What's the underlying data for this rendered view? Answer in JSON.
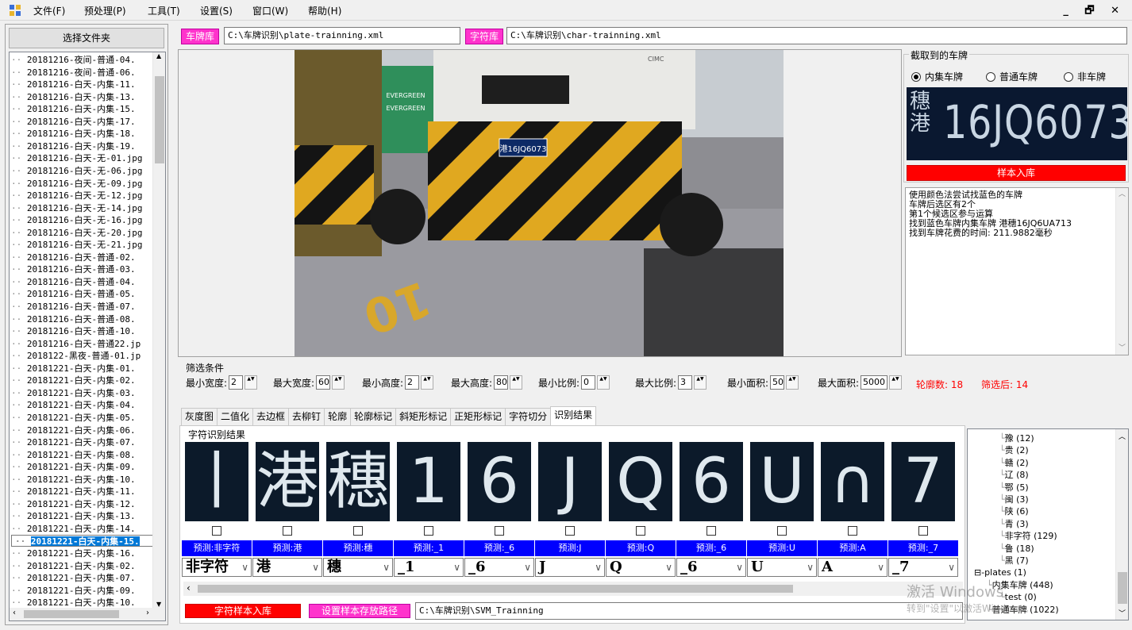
{
  "menu": {
    "items": [
      "文件(F)",
      "预处理(P)",
      "工具(T)",
      "设置(S)",
      "窗口(W)",
      "帮助(H)"
    ],
    "window_controls": "_ 🗗 ✕"
  },
  "left": {
    "folder_button": "选择文件夹",
    "files": [
      "20181216-夜间-普通-04.",
      "20181216-夜间-普通-06.",
      "20181216-白天-内集-11.",
      "20181216-白天-内集-13.",
      "20181216-白天-内集-15.",
      "20181216-白天-内集-17.",
      "20181216-白天-内集-18.",
      "20181216-白天-内集-19.",
      "20181216-白天-无-01.jpg",
      "20181216-白天-无-06.jpg",
      "20181216-白天-无-09.jpg",
      "20181216-白天-无-12.jpg",
      "20181216-白天-无-14.jpg",
      "20181216-白天-无-16.jpg",
      "20181216-白天-无-20.jpg",
      "20181216-白天-无-21.jpg",
      "20181216-白天-普通-02.",
      "20181216-白天-普通-03.",
      "20181216-白天-普通-04.",
      "20181216-白天-普通-05.",
      "20181216-白天-普通-07.",
      "20181216-白天-普通-08.",
      "20181216-白天-普通-10.",
      "20181216-白天-普通22.jp",
      "2018122-黑夜-普通-01.jp",
      "20181221-白天-内集-01.",
      "20181221-白天-内集-02.",
      "20181221-白天-内集-03.",
      "20181221-白天-内集-04.",
      "20181221-白天-内集-05.",
      "20181221-白天-内集-06.",
      "20181221-白天-内集-07.",
      "20181221-白天-内集-08.",
      "20181221-白天-内集-09.",
      "20181221-白天-内集-10.",
      "20181221-白天-内集-11.",
      "20181221-白天-内集-12.",
      "20181221-白天-内集-13.",
      "20181221-白天-内集-14.",
      "20181221-白天-内集-15.",
      "20181221-白天-内集-16.",
      "20181221-白天-内集-02.",
      "20181221-白天-内集-07.",
      "20181221-白天-内集-09.",
      "20181221-白天-内集-10."
    ],
    "selected_index": 39
  },
  "paths": {
    "plate_tag": "车牌库",
    "plate_path": "C:\\车牌识别\\plate-trainning.xml",
    "char_tag": "字符库",
    "char_path": "C:\\车牌识别\\char-trainning.xml"
  },
  "scene": {
    "banner1": "EVERGREEN",
    "banner2": "EVERGREEN",
    "plate_small": "港16JQ6073",
    "ground_number": "10",
    "truck_brand": "CIMC"
  },
  "plate_panel": {
    "title": "截取到的车牌",
    "options": [
      "内集车牌",
      "普通车牌",
      "非车牌"
    ],
    "selected_option": 0,
    "plate_prefix_top": "穗",
    "plate_prefix_bottom": "港",
    "plate_text": "16JQ6073",
    "sample_button": "样本入库"
  },
  "log": {
    "lines": [
      "使用颜色法尝试找蓝色的车牌",
      "车牌后选区有2个",
      "第1个候选区参与运算",
      "找到蓝色车牌内集车牌 港穗16JQ6UA713",
      "找到车牌花费的时间: 211.9882毫秒"
    ]
  },
  "filter": {
    "title": "筛选条件",
    "fields": [
      {
        "label": "最小宽度:",
        "value": "2"
      },
      {
        "label": "最大宽度:",
        "value": "60"
      },
      {
        "label": "最小高度:",
        "value": "2"
      },
      {
        "label": "最大高度:",
        "value": "80"
      },
      {
        "label": "最小比例:",
        "value": "0"
      },
      {
        "label": "最大比例:",
        "value": "3"
      },
      {
        "label": "最小面积:",
        "value": "50"
      },
      {
        "label": "最大面积:",
        "value": "5000"
      }
    ],
    "contour_count": "轮廓数: 18",
    "after_filter": "筛选后: 14"
  },
  "tabs": {
    "items": [
      "灰度图",
      "二值化",
      "去边框",
      "去柳钉",
      "轮廓",
      "轮廓标记",
      "斜矩形标记",
      "正矩形标记",
      "字符切分",
      "识别结果"
    ],
    "active": 9
  },
  "recognition": {
    "title": "字符识别结果",
    "chars": [
      {
        "glyph": "丨",
        "pred": "预测:非字符",
        "select": "非字符"
      },
      {
        "glyph": "港",
        "pred": "预测:港",
        "select": "港"
      },
      {
        "glyph": "穗",
        "pred": "预测:穗",
        "select": "穗"
      },
      {
        "glyph": "1",
        "pred": "预测:_1",
        "select": "_1"
      },
      {
        "glyph": "6",
        "pred": "预测:_6",
        "select": "_6"
      },
      {
        "glyph": "J",
        "pred": "预测:J",
        "select": "J"
      },
      {
        "glyph": "Q",
        "pred": "预测:Q",
        "select": "Q"
      },
      {
        "glyph": "6",
        "pred": "预测:_6",
        "select": "_6"
      },
      {
        "glyph": "U",
        "pred": "预测:U",
        "select": "U"
      },
      {
        "glyph": "∩",
        "pred": "预测:A",
        "select": "A"
      },
      {
        "glyph": "7",
        "pred": "预测:_7",
        "select": "_7"
      }
    ],
    "char_sample_button": "字符样本入库",
    "set_path_button": "设置样本存放路径",
    "sample_path": "C:\\车牌识别\\SVM_Trainning"
  },
  "tree": {
    "nodes": [
      {
        "text": "豫 (12)",
        "indent": 2
      },
      {
        "text": "贵 (2)",
        "indent": 2
      },
      {
        "text": "赣 (2)",
        "indent": 2
      },
      {
        "text": "辽 (8)",
        "indent": 2
      },
      {
        "text": "鄂 (5)",
        "indent": 2
      },
      {
        "text": "闽 (3)",
        "indent": 2
      },
      {
        "text": "陕 (6)",
        "indent": 2
      },
      {
        "text": "青 (3)",
        "indent": 2
      },
      {
        "text": "非字符 (129)",
        "indent": 2
      },
      {
        "text": "鲁 (18)",
        "indent": 2
      },
      {
        "text": "黑 (7)",
        "indent": 2
      },
      {
        "text": "⊟-plates (1)",
        "indent": 0
      },
      {
        "text": "内集车牌 (448)",
        "indent": 1
      },
      {
        "text": "test (0)",
        "indent": 2
      },
      {
        "text": "普通车牌 (1022)",
        "indent": 1
      }
    ]
  },
  "watermark": {
    "line1": "激活 Windows",
    "line2": "转到\"设置\"以激活Windows。"
  },
  "colors": {
    "pink": "#ff33cc",
    "red": "#ff0000",
    "blue": "#0000ff",
    "selection": "#0078d7"
  }
}
